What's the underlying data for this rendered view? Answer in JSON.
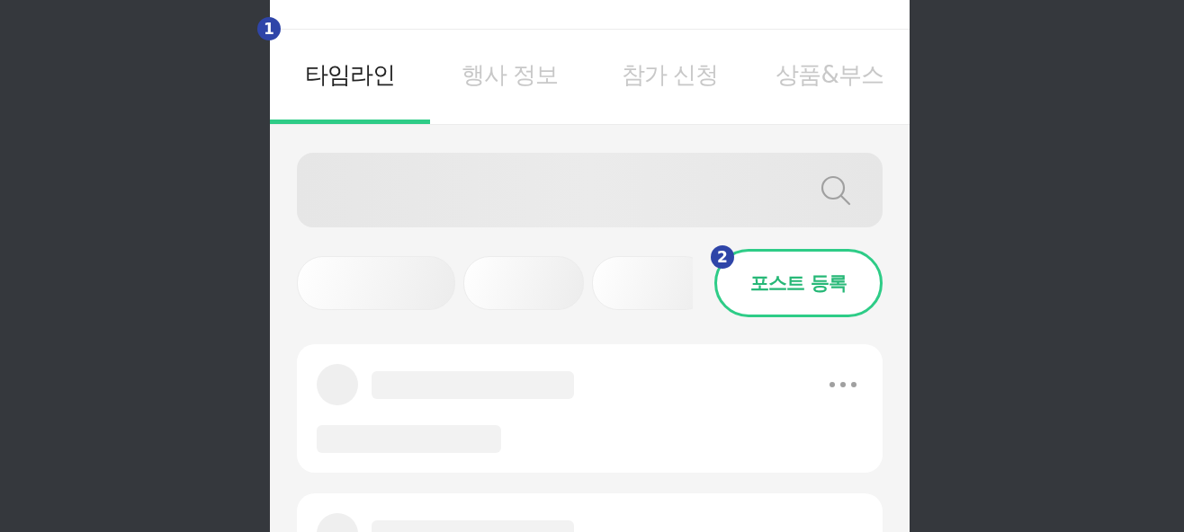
{
  "tabs": [
    {
      "label": "타임라인",
      "selected": true
    },
    {
      "label": "행사 정보",
      "selected": false
    },
    {
      "label": "참가 신청",
      "selected": false
    },
    {
      "label": "상품&부스",
      "selected": false
    }
  ],
  "markers": [
    {
      "label": "1"
    },
    {
      "label": "2"
    }
  ],
  "post_button": {
    "label": "포스트 등록"
  }
}
